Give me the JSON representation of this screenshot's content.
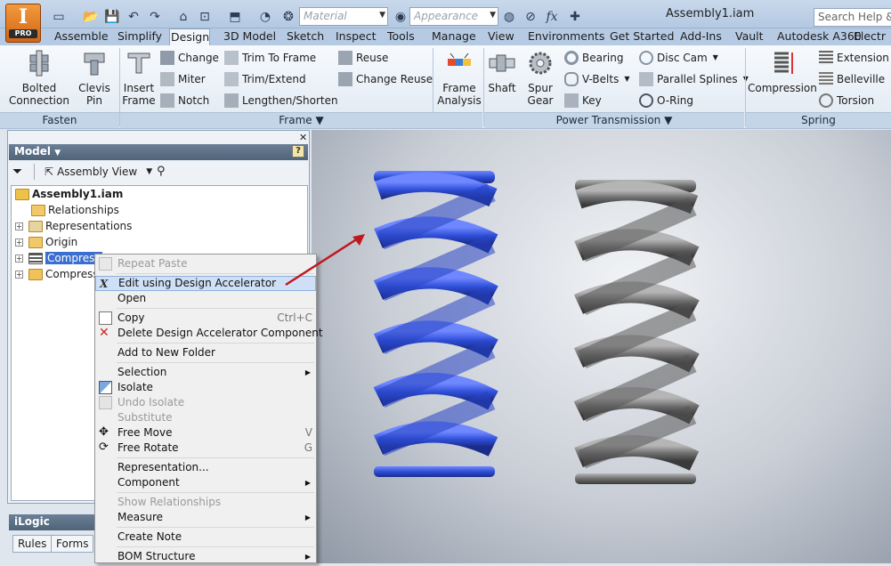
{
  "app": {
    "logo_letter": "I",
    "edition": "PRO",
    "document_title": "Assembly1.iam",
    "search_placeholder": "Search Help & C"
  },
  "quick_access": {
    "material_placeholder": "Material",
    "appearance_placeholder": "Appearance",
    "fx_label": "fx"
  },
  "ribbon_tabs": [
    "Assemble",
    "Simplify",
    "Design",
    "3D Model",
    "Sketch",
    "Inspect",
    "Tools",
    "Manage",
    "View",
    "Environments",
    "Get Started",
    "Add-Ins",
    "Vault",
    "Autodesk A360",
    "Electr"
  ],
  "active_tab": "Design",
  "ribbon": {
    "fasten": {
      "label": "Fasten",
      "bolted": "Bolted\nConnection",
      "clevis": "Clevis\nPin"
    },
    "frame": {
      "label": "Frame",
      "insert": "Insert\nFrame",
      "change": "Change",
      "miter": "Miter",
      "notch": "Notch",
      "trim_to_frame": "Trim To Frame",
      "trim_extend": "Trim/Extend",
      "lengthen": "Lengthen/Shorten",
      "reuse": "Reuse",
      "change_reuse": "Change Reuse",
      "frame_analysis": "Frame\nAnalysis"
    },
    "power": {
      "label": "Power Transmission",
      "shaft": "Shaft",
      "spur": "Spur\nGear",
      "bearing": "Bearing",
      "vbelts": "V-Belts",
      "key": "Key",
      "disc_cam": "Disc Cam",
      "splines": "Parallel Splines",
      "oring": "O-Ring"
    },
    "spring": {
      "label": "Spring",
      "compression": "Compression",
      "extension": "Extension",
      "belleville": "Belleville",
      "torsion": "Torsion"
    }
  },
  "browser": {
    "title": "Model",
    "view_label": "Assembly View",
    "tree": [
      {
        "label": "Assembly1.iam"
      },
      {
        "label": "Relationships"
      },
      {
        "label": "Representations"
      },
      {
        "label": "Origin"
      },
      {
        "label": "Compress"
      },
      {
        "label": "Compress S"
      }
    ]
  },
  "ilogic": {
    "title": "iLogic",
    "tabs": [
      "Rules",
      "Forms"
    ]
  },
  "context_menu": {
    "items": [
      {
        "label": "Repeat Paste",
        "disabled": true
      },
      {
        "label": "Edit using Design Accelerator",
        "highlighted": true
      },
      {
        "label": "Open"
      },
      {
        "label": "Copy",
        "shortcut": "Ctrl+C"
      },
      {
        "label": "Delete Design Accelerator Component"
      },
      {
        "label": "Add to New Folder"
      },
      {
        "label": "Selection",
        "submenu": true
      },
      {
        "label": "Isolate"
      },
      {
        "label": "Undo Isolate",
        "disabled": true
      },
      {
        "label": "Substitute",
        "disabled": true
      },
      {
        "label": "Free Move",
        "shortcut": "V"
      },
      {
        "label": "Free Rotate",
        "shortcut": "G"
      },
      {
        "label": "Representation..."
      },
      {
        "label": "Component",
        "submenu": true
      },
      {
        "label": "Show Relationships",
        "disabled": true
      },
      {
        "label": "Measure",
        "submenu": true
      },
      {
        "label": "Create Note"
      },
      {
        "label": "BOM Structure",
        "submenu": true
      }
    ]
  },
  "colors": {
    "selected_spring": "#2f4fd9",
    "unselected_spring": "#6e6e6e",
    "arrow": "#c0181e"
  }
}
